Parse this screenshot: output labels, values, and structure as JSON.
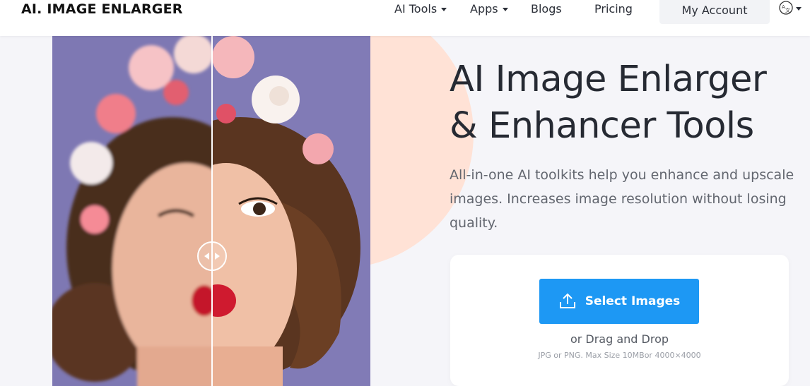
{
  "header": {
    "logo": "AI. IMAGE ENLARGER",
    "nav": [
      {
        "label": "AI Tools",
        "dropdown": true
      },
      {
        "label": "Apps",
        "dropdown": true
      },
      {
        "label": "Blogs",
        "dropdown": false
      },
      {
        "label": "Pricing",
        "dropdown": false
      }
    ],
    "account_label": "My Account",
    "language_icon": "language-icon"
  },
  "hero": {
    "title_line1": "AI Image Enlarger",
    "title_line2": "& Enhancer Tools",
    "description": "All-in-one AI toolkits help you enhance and upscale images. Increases image resolution without losing quality."
  },
  "upload": {
    "button_label": "Select Images",
    "button_icon": "upload-icon",
    "drag_text": "or Drag and Drop",
    "limits_text": "JPG or PNG. Max Size 10MBor 4000×4000"
  },
  "colors": {
    "accent": "#1d98f4",
    "background": "#f5f5f9",
    "peach": "#ffe2d6",
    "photo_bg": "#7f79b4"
  }
}
